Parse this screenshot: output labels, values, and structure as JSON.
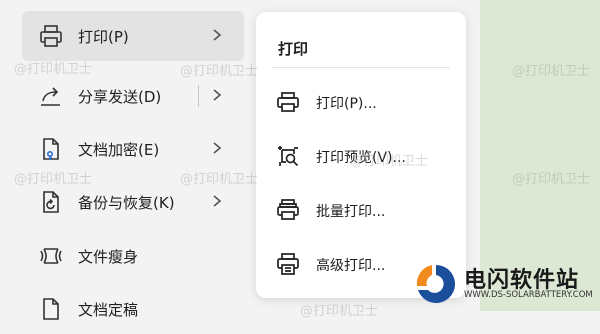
{
  "menu": {
    "items": [
      {
        "label": "打印(P)",
        "icon": "printer-icon",
        "has_submenu": true,
        "active": true
      },
      {
        "label": "分享发送(D)",
        "icon": "share-icon",
        "has_submenu": true
      },
      {
        "label": "文档加密(E)",
        "icon": "document-lock-icon",
        "has_submenu": true
      },
      {
        "label": "备份与恢复(K)",
        "icon": "backup-icon",
        "has_submenu": true
      },
      {
        "label": "文件瘦身",
        "icon": "file-slim-icon",
        "has_submenu": false
      },
      {
        "label": "文档定稿",
        "icon": "document-finalize-icon",
        "has_submenu": false
      }
    ]
  },
  "submenu": {
    "title": "打印",
    "items": [
      {
        "label": "打印(P)...",
        "icon": "printer-icon"
      },
      {
        "label": "打印预览(V)...",
        "icon": "print-preview-icon"
      },
      {
        "label": "批量打印...",
        "icon": "batch-print-icon"
      },
      {
        "label": "高级打印...",
        "icon": "advanced-print-icon"
      }
    ]
  },
  "watermark": "@打印机卫士",
  "brand": {
    "name": "电闪软件站",
    "url": "WWW.DS-SOLARBATTERY.COM",
    "colors": {
      "blue": "#1b4f9c",
      "orange": "#f08a1c"
    }
  }
}
